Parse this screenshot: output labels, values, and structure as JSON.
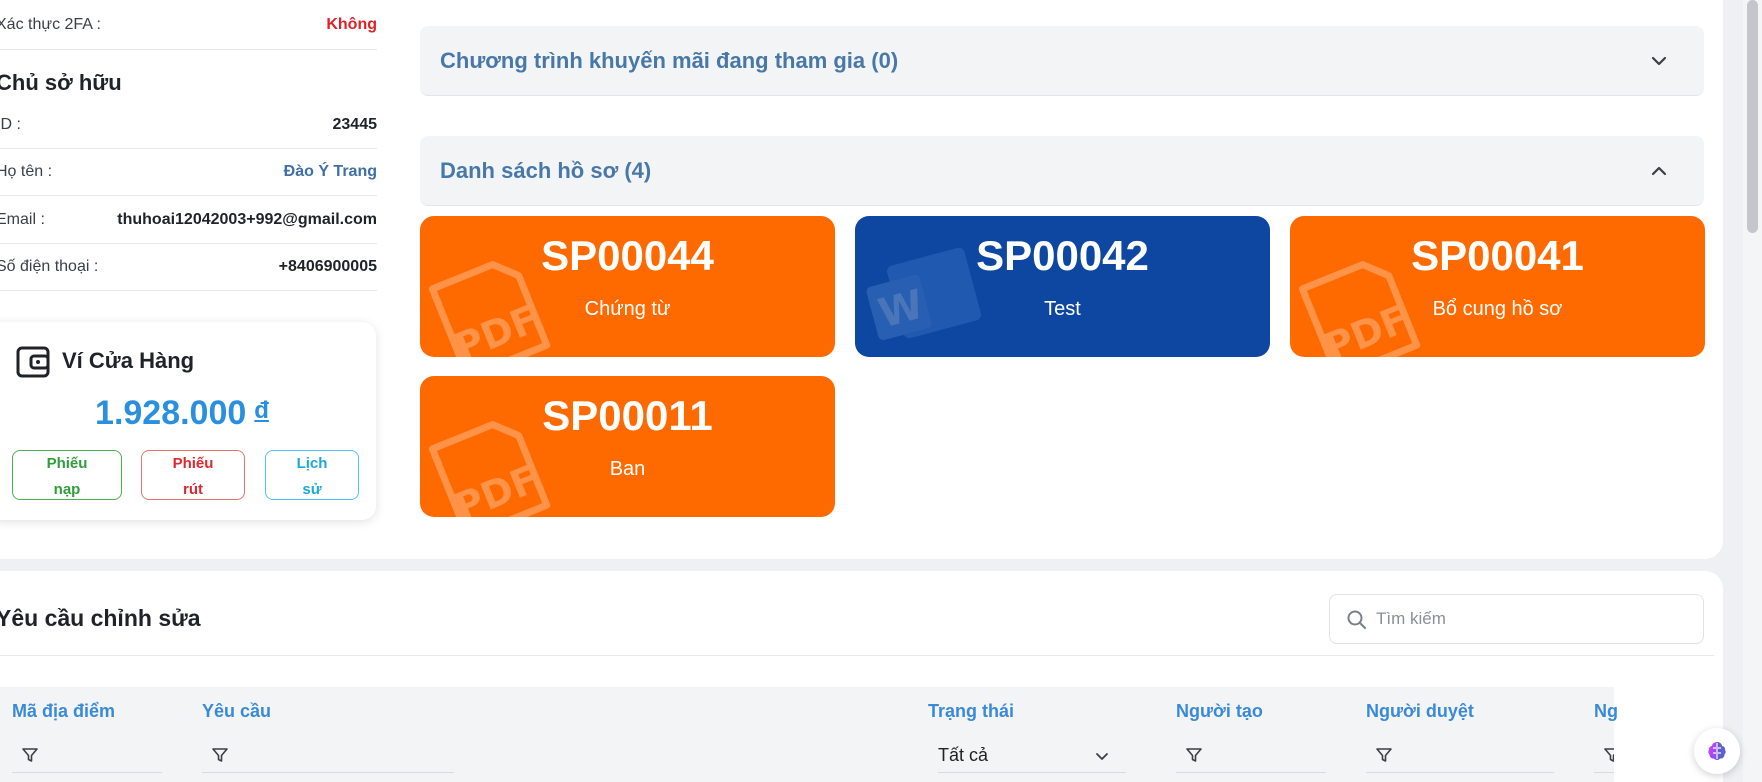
{
  "info_rows": [
    {
      "label": "Xác thực 2FA :",
      "value": "Không"
    }
  ],
  "owner": {
    "title": "Chủ sở hữu",
    "rows": [
      {
        "label": "ID :",
        "value": "23445"
      },
      {
        "label": "Họ tên :",
        "value": "Đào Ý Trang"
      },
      {
        "label": "Email :",
        "value": "thuhoai12042003+992@gmail.com"
      },
      {
        "label": "Số điện thoại :",
        "value": "+8406900005"
      }
    ]
  },
  "wallet": {
    "title": "Ví Cửa Hàng",
    "amount": "1.928.000",
    "currency": "đ",
    "buttons": {
      "deposit_l1": "Phiếu",
      "deposit_l2": "nạp",
      "withdraw_l1": "Phiếu",
      "withdraw_l2": "rút",
      "history_l1": "Lịch",
      "history_l2": "sử"
    }
  },
  "promotions": {
    "title": "Chương trình khuyến mãi đang tham gia (0)"
  },
  "files": {
    "title": "Danh sách hồ sơ (4)",
    "items": [
      {
        "code": "SP00044",
        "name": "Chứng từ",
        "type": "pdf"
      },
      {
        "code": "SP00042",
        "name": "Test",
        "type": "word"
      },
      {
        "code": "SP00041",
        "name": "Bổ cung hồ sơ",
        "type": "pdf"
      },
      {
        "code": "SP00011",
        "name": "Ban",
        "type": "pdf"
      }
    ]
  },
  "edit_requests": {
    "title": "Yêu cầu chỉnh sửa",
    "search_placeholder": "Tìm kiếm",
    "columns": [
      "Mã địa điểm",
      "Yêu cầu",
      "Trạng thái",
      "Người tạo",
      "Người duyệt",
      "Ng"
    ],
    "status_filter": "Tất cả"
  },
  "colors": {
    "pdf_card": "#ff6a00",
    "word_card": "#0d47a1",
    "accent_blue": "#2b8fe0",
    "danger": "#e41e26"
  }
}
